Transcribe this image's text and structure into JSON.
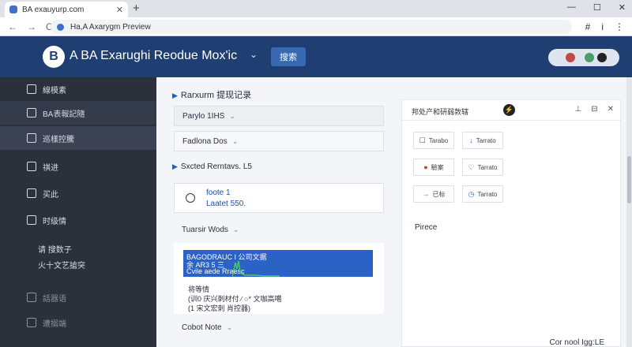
{
  "browser": {
    "tab_title": "BA exauyurp.com",
    "close_glyph": "✕",
    "newtab_glyph": "+",
    "window_controls": [
      "—",
      "☐",
      "✕"
    ],
    "address_text": "Ha,A Axarygm Preview",
    "nav": {
      "back": "←",
      "forward": "→",
      "reload": "C"
    },
    "right_icons": [
      "#",
      "i",
      "⋮"
    ]
  },
  "header": {
    "logo_letter": "B",
    "title": "A BA Exarughi Reodue Mox'ic",
    "caret": "⌄",
    "search_label": "搜索",
    "accent": "#1f3f73"
  },
  "sidebar": {
    "items": [
      {
        "label": "線模素"
      },
      {
        "label": "BA表報記隨"
      },
      {
        "label": "巡樣控騰"
      },
      {
        "label": "祺进"
      },
      {
        "label": "买此"
      },
      {
        "label": "时级情"
      }
    ],
    "sub": [
      "请 搜数子",
      "火十文艺搶突"
    ],
    "bottom": [
      "話器语",
      "遭搦端"
    ]
  },
  "main": {
    "section1": "Rarxurm 提现记录",
    "select1": "Parylo 1IHS",
    "select2": "Fadlona Dos",
    "section2": "Sxcted Rerntavs. L5",
    "card": {
      "line1": "foote 1",
      "line2": "Laatet 550."
    },
    "select3": "Tuarsir Wods",
    "chart": {
      "line1": "BAGODRAUC I 公司文据",
      "line2": "余 AR3 5 三",
      "line3": "Cvile aede Rraesc"
    },
    "below_chart": [
      "将等情",
      "(训0 庆兴刺材付 ∕ ○* 文咖高噶",
      "(1 宋文宏刺 肖控器)"
    ],
    "select4": "Cobot Note"
  },
  "right_panel": {
    "title": "邦处产和研弱敦辖",
    "badge": "⚡",
    "controls": [
      "⊥",
      "⊟",
      "✕"
    ],
    "buttons": [
      {
        "icon": "☐",
        "label": "Tarabo"
      },
      {
        "icon": "↓",
        "label": "Tarrato"
      },
      {
        "icon": "●",
        "label": "驗案"
      },
      {
        "icon": "♡",
        "label": "Tarrato"
      },
      {
        "icon": "→",
        "label": "已标"
      },
      {
        "icon": "◷",
        "label": "Tarrato"
      }
    ],
    "link": "Pirece",
    "footer": "Cor nool Igg:LE"
  }
}
